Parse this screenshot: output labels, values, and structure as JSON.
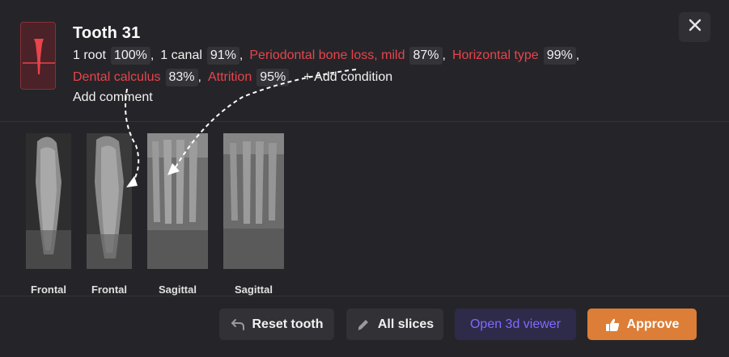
{
  "tooth": {
    "title": "Tooth 31",
    "icon": "tooth-icon"
  },
  "conditions": [
    {
      "name": "1 root",
      "pct": "100%",
      "color": "#f2f2f2"
    },
    {
      "name": "1 canal",
      "pct": "91%",
      "color": "#f2f2f2"
    },
    {
      "name": "Periodontal bone loss, mild",
      "pct": "87%",
      "color": "#e8444c"
    },
    {
      "name": "Horizontal type",
      "pct": "99%",
      "color": "#e8444c"
    },
    {
      "name": "Dental calculus",
      "pct": "83%",
      "color": "#e8444c"
    },
    {
      "name": "Attrition",
      "pct": "95%",
      "color": "#e8444c"
    }
  ],
  "add_condition_label": "+ Add condition",
  "add_comment_label": "Add comment",
  "separator": ",",
  "slices": [
    {
      "label": "Frontal"
    },
    {
      "label": "Frontal"
    },
    {
      "label": "Sagittal"
    },
    {
      "label": "Sagittal"
    }
  ],
  "footer": {
    "reset_label": "Reset tooth",
    "all_slices_label": "All slices",
    "open_3d_label": "Open 3d viewer",
    "approve_label": "Approve"
  },
  "colors": {
    "accent_red": "#e8444c",
    "approve_orange": "#dc7e37",
    "viewer_purple": "#7d6cff"
  }
}
